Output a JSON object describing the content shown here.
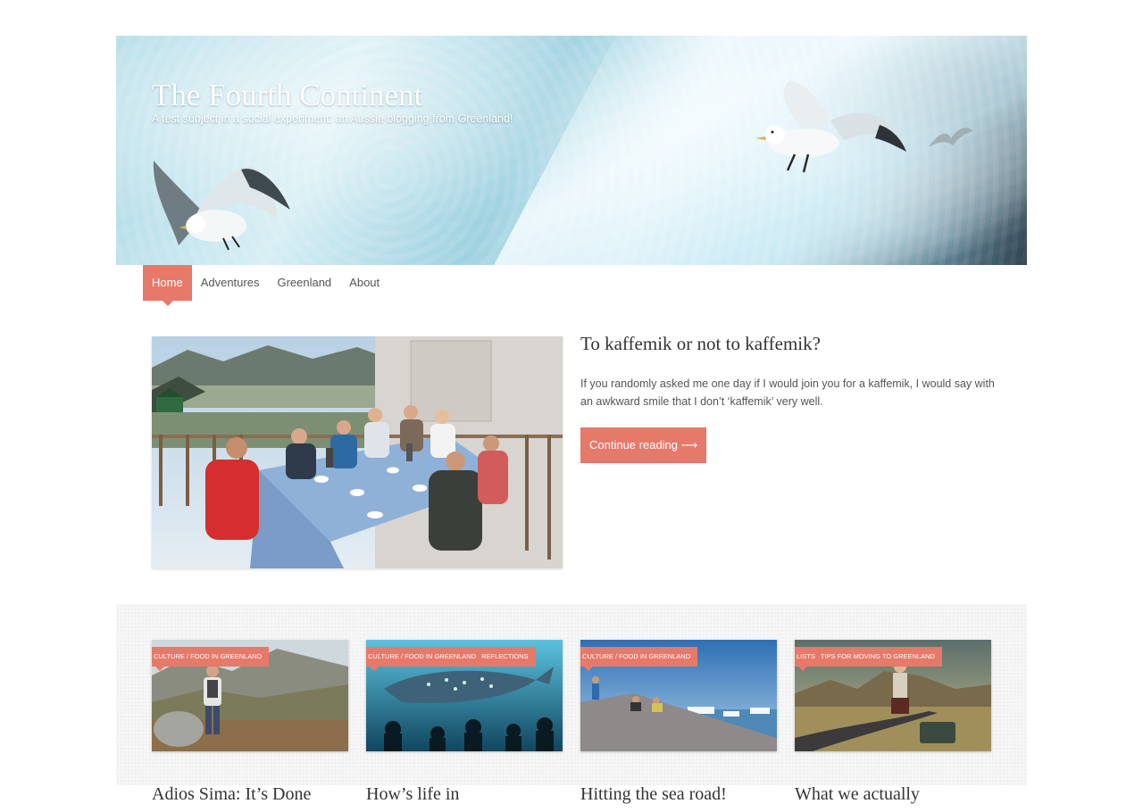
{
  "site": {
    "title": "The Fourth Continent",
    "description": "A test subject in a social experiment: an Aussie blogging from Greenland!"
  },
  "nav": {
    "items": [
      {
        "label": "Home",
        "active": true
      },
      {
        "label": "Adventures",
        "active": false
      },
      {
        "label": "Greenland",
        "active": false
      },
      {
        "label": "About",
        "active": false
      }
    ]
  },
  "featured": {
    "title": "To kaffemik or not to kaffemik?",
    "excerpt": "If you randomly asked me one day if I would join you for a kaffemik, I would say with an awkward smile that I don’t ‘kaffemik’ very well.",
    "button_label": "Continue reading ⟶"
  },
  "posts": [
    {
      "categories": [
        "Culture / Food in Greenland"
      ],
      "title": "Adios Sima: It’s Done"
    },
    {
      "categories": [
        "Culture / Food in Greenland",
        "Reflections"
      ],
      "title": "How’s life in"
    },
    {
      "categories": [
        "Culture / Food in Greenland"
      ],
      "title": "Hitting the sea road!"
    },
    {
      "categories": [
        "Lists",
        "Tips for moving to Greenland"
      ],
      "title": "What we actually"
    }
  ],
  "colors": {
    "accent": "#e6796a",
    "text": "#444444",
    "grid_background": "#f6f6f6"
  }
}
